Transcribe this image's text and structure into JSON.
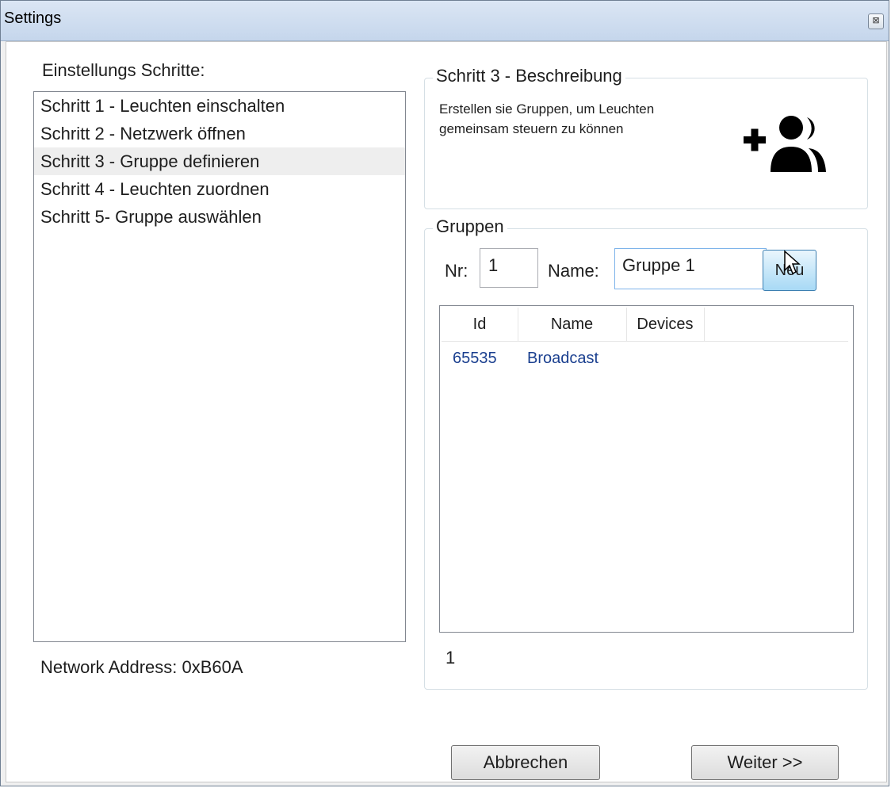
{
  "window": {
    "title": "Settings",
    "close_glyph": "⊠"
  },
  "steps": {
    "label": "Einstellungs Schritte:",
    "items": [
      "Schritt 1 - Leuchten einschalten",
      "Schritt 2 - Netzwerk öffnen",
      "Schritt 3 - Gruppe definieren",
      "Schritt 4 - Leuchten zuordnen",
      "Schritt 5- Gruppe auswählen"
    ],
    "selected_index": 2
  },
  "network_address": "Network Address: 0xB60A",
  "description": {
    "title": "Schritt 3 - Beschreibung",
    "text_line1": "Erstellen sie Gruppen, um Leuchten",
    "text_line2": "gemeinsam steuern zu können",
    "icon": "add-group-icon"
  },
  "groups": {
    "title": "Gruppen",
    "nr_label": "Nr:",
    "nr_value": "1",
    "name_label": "Name:",
    "name_value": "Gruppe 1",
    "new_button": "Neu",
    "columns": [
      "Id",
      "Name",
      "Devices"
    ],
    "rows": [
      {
        "id": "65535",
        "name": "Broadcast",
        "devices": ""
      }
    ],
    "count": "1"
  },
  "buttons": {
    "cancel": "Abbrechen",
    "next": "Weiter >>"
  },
  "colors": {
    "accent": "#7eb4ea",
    "row_text": "#1a3f8f",
    "selected_bg": "#eeeeee"
  }
}
